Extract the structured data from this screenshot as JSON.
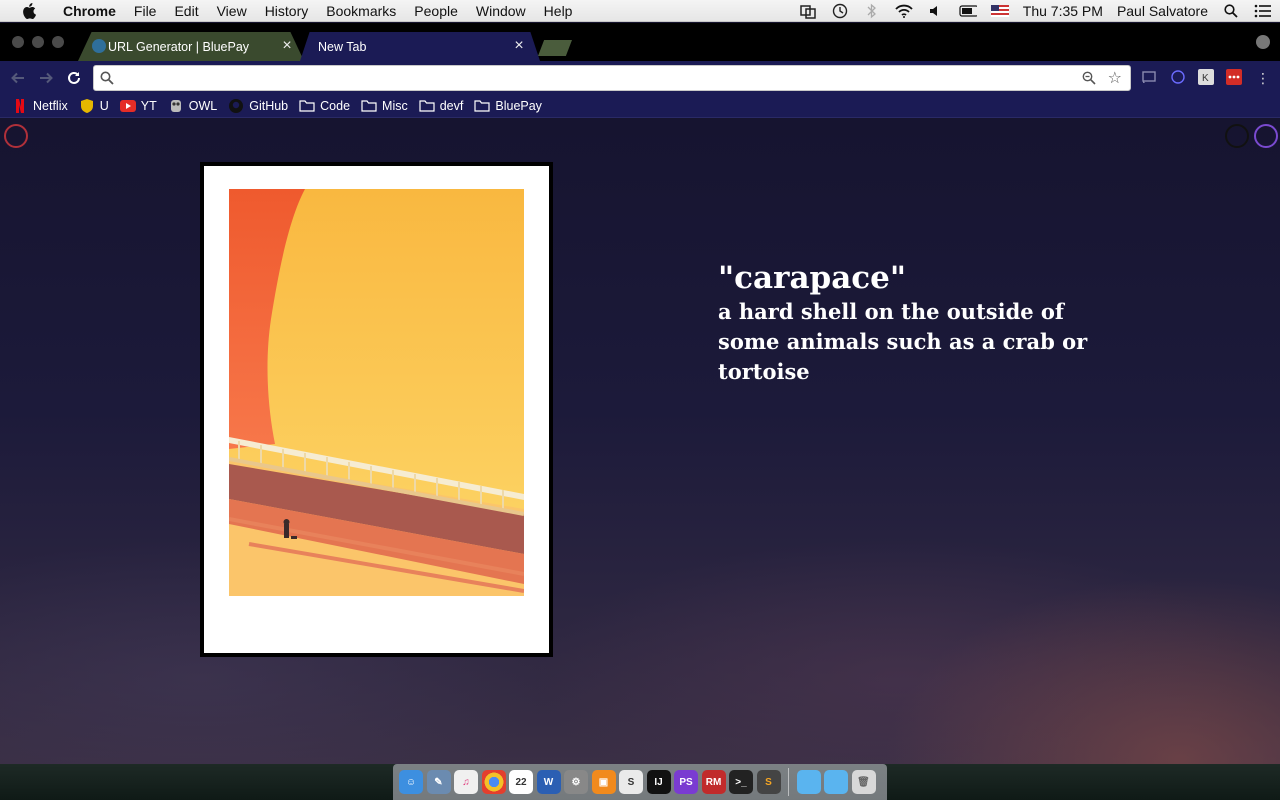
{
  "menubar": {
    "app": "Chrome",
    "items": [
      "File",
      "Edit",
      "View",
      "History",
      "Bookmarks",
      "People",
      "Window",
      "Help"
    ],
    "clock": "Thu 7:35 PM",
    "user": "Paul Salvatore"
  },
  "tabs": [
    {
      "title": "URL Generator | BluePay"
    },
    {
      "title": "New Tab"
    }
  ],
  "omnibox": {
    "value": ""
  },
  "bookmarks": [
    {
      "label": "Netflix",
      "icon": "netflix-icon"
    },
    {
      "label": "U",
      "icon": "shield-icon"
    },
    {
      "label": "YT",
      "icon": "youtube-icon"
    },
    {
      "label": "OWL",
      "icon": "owl-icon"
    },
    {
      "label": "GitHub",
      "icon": "github-icon"
    },
    {
      "label": "Code",
      "icon": "folder-icon"
    },
    {
      "label": "Misc",
      "icon": "folder-icon"
    },
    {
      "label": "devf",
      "icon": "folder-icon"
    },
    {
      "label": "BluePay",
      "icon": "folder-icon"
    }
  ],
  "word": {
    "term": "\"carapace\"",
    "definition": "a hard shell on the outside of some animals such as a crab or tortoise"
  },
  "dock": {
    "calendar_day": "22",
    "apps": [
      "finder",
      "preview",
      "itunes",
      "chrome",
      "calendar",
      "word",
      "system-preferences",
      "ibooks",
      "sublime",
      "intellij",
      "phpstorm",
      "rubymine",
      "terminal",
      "sublime-text"
    ]
  },
  "colors": {
    "chrome_theme": "#1b1b55",
    "corner_left": "#b0303a",
    "corner_right_1": "#111111",
    "corner_right_2": "#7a4ad0"
  }
}
